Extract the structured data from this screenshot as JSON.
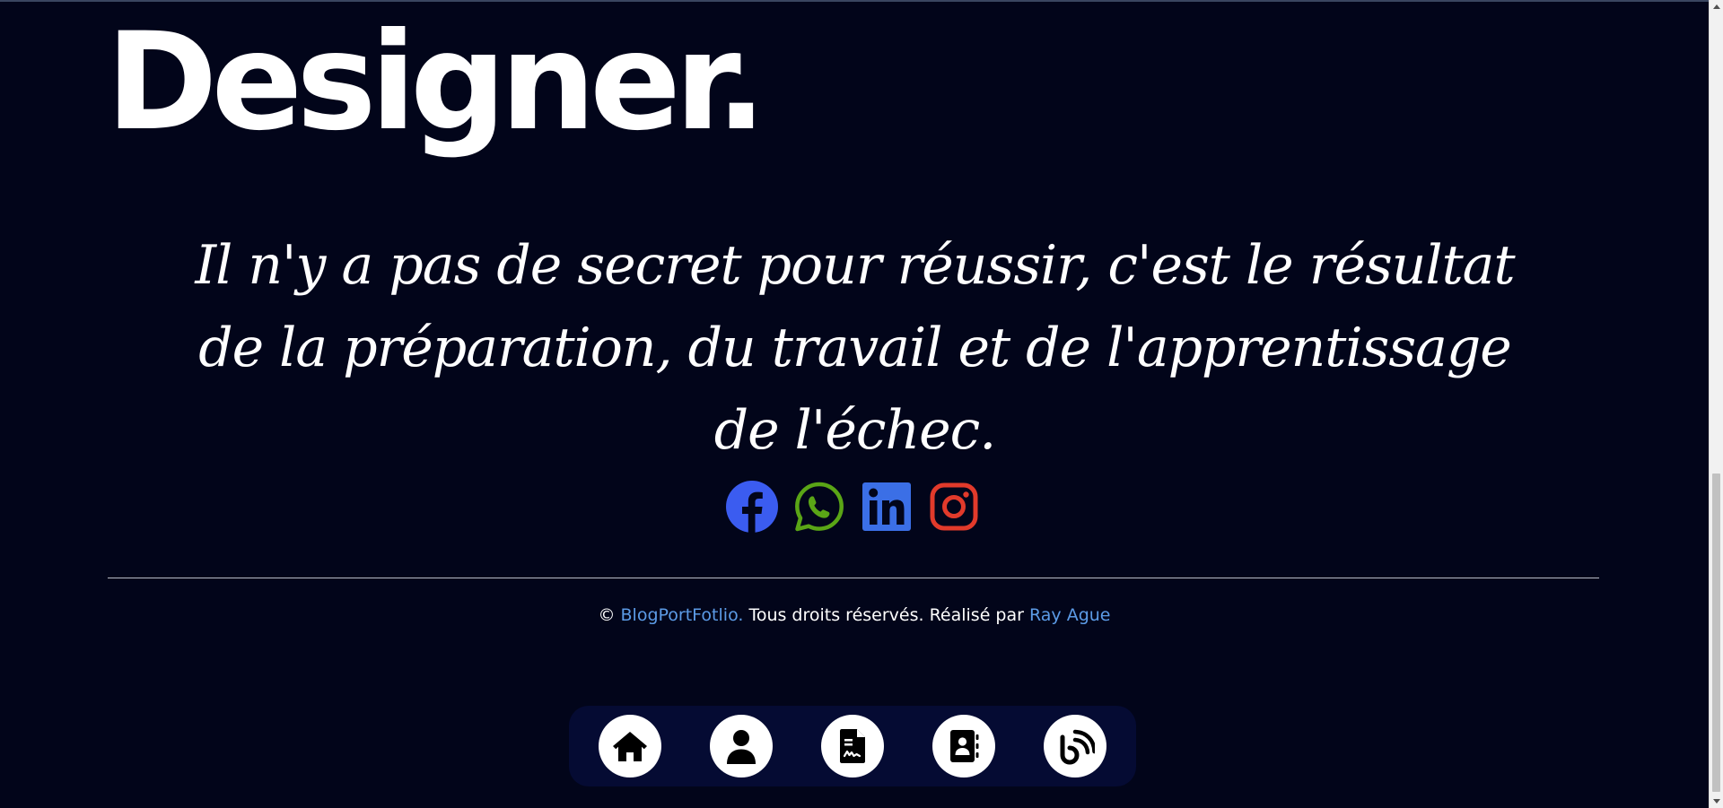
{
  "hero": {
    "heading": "Designer."
  },
  "quote": {
    "text": "Il n'y a pas de secret pour réussir, c'est le résultat de la préparation, du travail et de l'apprentissage de l'échec."
  },
  "socials": [
    {
      "name": "Facebook",
      "icon": "facebook-icon",
      "color": "#3b5cf0"
    },
    {
      "name": "WhatsApp",
      "icon": "whatsapp-icon",
      "color": "#5aa516"
    },
    {
      "name": "LinkedIn",
      "icon": "linkedin-icon",
      "color": "#3b6fe6"
    },
    {
      "name": "Instagram",
      "icon": "instagram-icon",
      "color": "#e23a2b"
    }
  ],
  "footer": {
    "copyright_symbol": "©",
    "brand": "BlogPortFotlio.",
    "rights": " Tous droits réservés. Réalisé par ",
    "author": "Ray Ague",
    "link_color": "#5c9be6"
  },
  "dock": {
    "items": [
      {
        "icon": "home-icon"
      },
      {
        "icon": "user-icon"
      },
      {
        "icon": "file-signature-icon"
      },
      {
        "icon": "address-book-icon"
      },
      {
        "icon": "blog-icon"
      }
    ]
  },
  "colors": {
    "background": "#02051a",
    "dock_background": "#050b33",
    "text": "#ffffff"
  }
}
